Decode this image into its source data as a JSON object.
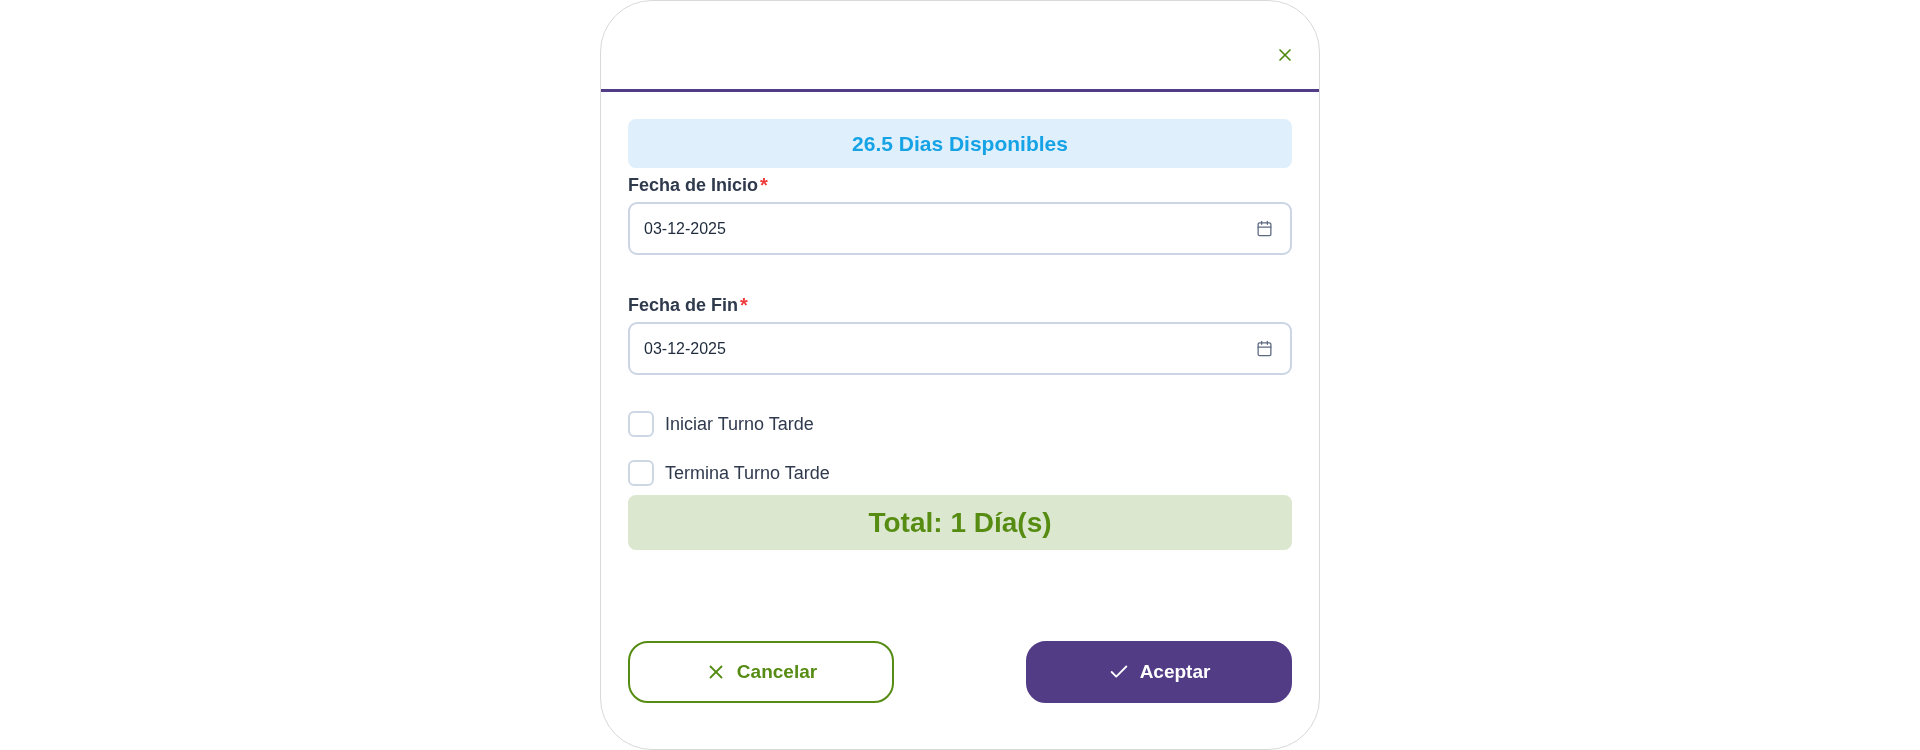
{
  "available_days": "26.5 Dias Disponibles",
  "fields": [
    {
      "label": "Fecha de Inicio",
      "required_mark": "*",
      "value": "03-12-2025"
    },
    {
      "label": "Fecha de Fin",
      "required_mark": "*",
      "value": "03-12-2025"
    }
  ],
  "checkboxes": [
    {
      "label": "Iniciar Turno Tarde",
      "checked": false
    },
    {
      "label": "Termina Turno Tarde",
      "checked": false
    }
  ],
  "total": "Total: 1 Día(s)",
  "buttons": [
    {
      "kind": "cancel",
      "label": "Cancelar"
    },
    {
      "kind": "accept",
      "label": "Aceptar"
    }
  ]
}
